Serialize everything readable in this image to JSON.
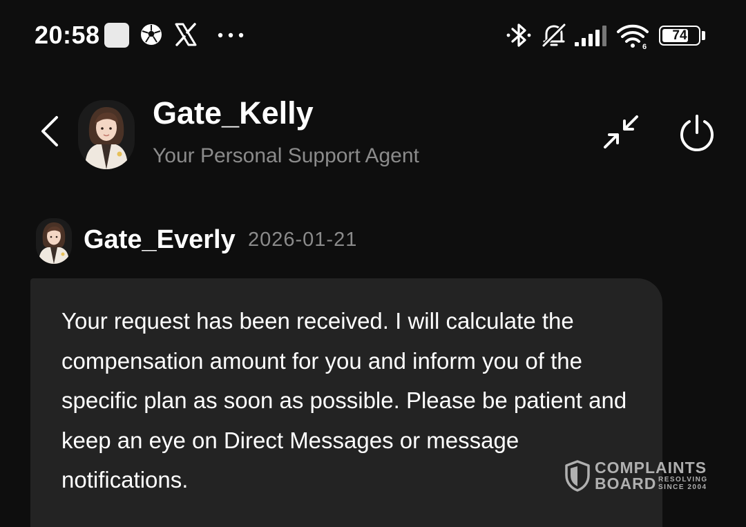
{
  "status_bar": {
    "time": "20:58",
    "battery": "74",
    "battery_level": 0.74,
    "wifi_badge": "6",
    "icons": [
      "notification-square-icon",
      "soccer-ball-icon",
      "x-logo-icon",
      "more-dots-icon",
      "bluetooth-icon",
      "bell-muted-icon",
      "signal-icon",
      "wifi-icon",
      "battery-icon"
    ]
  },
  "header": {
    "agent_name": "Gate_Kelly",
    "agent_subtitle": "Your Personal Support Agent"
  },
  "message": {
    "sender": "Gate_Everly",
    "date": "2026-01-21",
    "text": "Your request has been received. I will calculate the compensation amount for you and inform you of the specific plan as soon as possible. Please be patient and keep an eye on Direct Messages or message notifications."
  },
  "watermark": {
    "line1": "COMPLAINTS",
    "line2": "BOARD",
    "tag1": "RESOLVING",
    "tag2": "SINCE 2004"
  },
  "colors": {
    "background": "#0e0e0e",
    "bubble": "#232323",
    "secondary_text": "#8b8b8b"
  }
}
